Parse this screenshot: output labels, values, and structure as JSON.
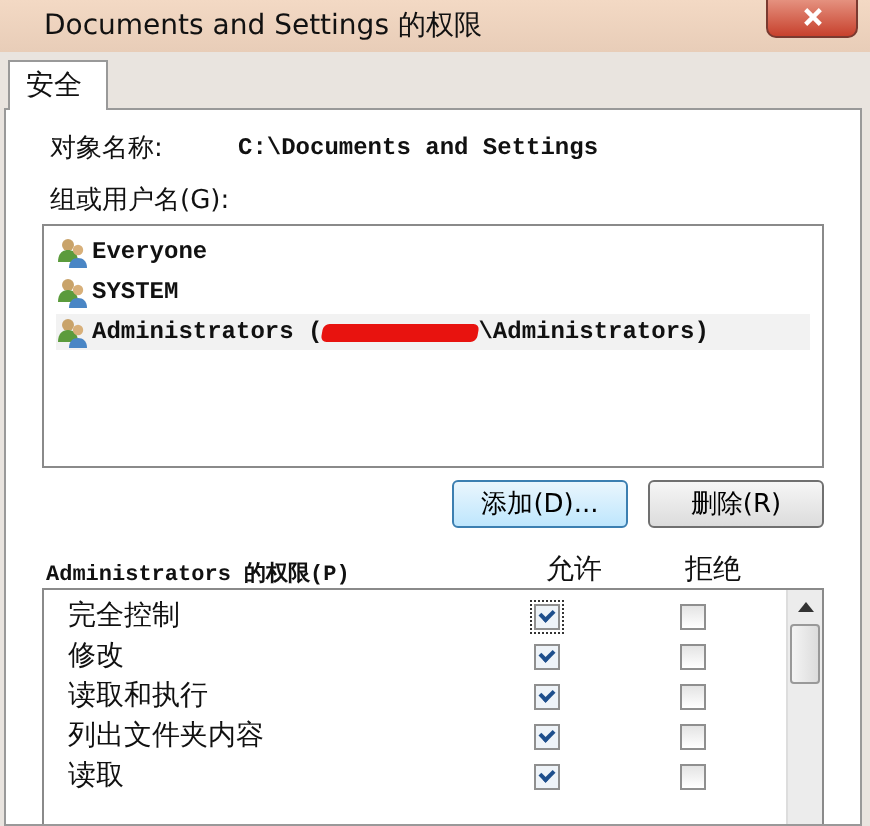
{
  "window": {
    "title": "Documents and Settings 的权限"
  },
  "tabs": [
    {
      "label": "安全",
      "selected": true
    }
  ],
  "object_name": {
    "label": "对象名称:",
    "value": "C:\\Documents and Settings"
  },
  "users": {
    "label": "组或用户名(G):",
    "items": [
      {
        "name": "Everyone",
        "selected": false
      },
      {
        "name": "SYSTEM",
        "selected": false
      },
      {
        "name": "Administrators (",
        "name_end": "\\Administrators)",
        "redacted": true,
        "selected": true
      }
    ]
  },
  "buttons": [
    "添加(D)...",
    "删除(R)"
  ],
  "permissions": {
    "label": "Administrators 的权限(P)",
    "allow_header": "允许",
    "deny_header": "拒绝",
    "rows": [
      {
        "name": "完全控制",
        "allow": true,
        "deny": false,
        "focused": true
      },
      {
        "name": "修改",
        "allow": true,
        "deny": false
      },
      {
        "name": "读取和执行",
        "allow": true,
        "deny": false
      },
      {
        "name": "列出文件夹内容",
        "allow": true,
        "deny": false
      },
      {
        "name": "读取",
        "allow": true,
        "deny": false
      }
    ]
  }
}
